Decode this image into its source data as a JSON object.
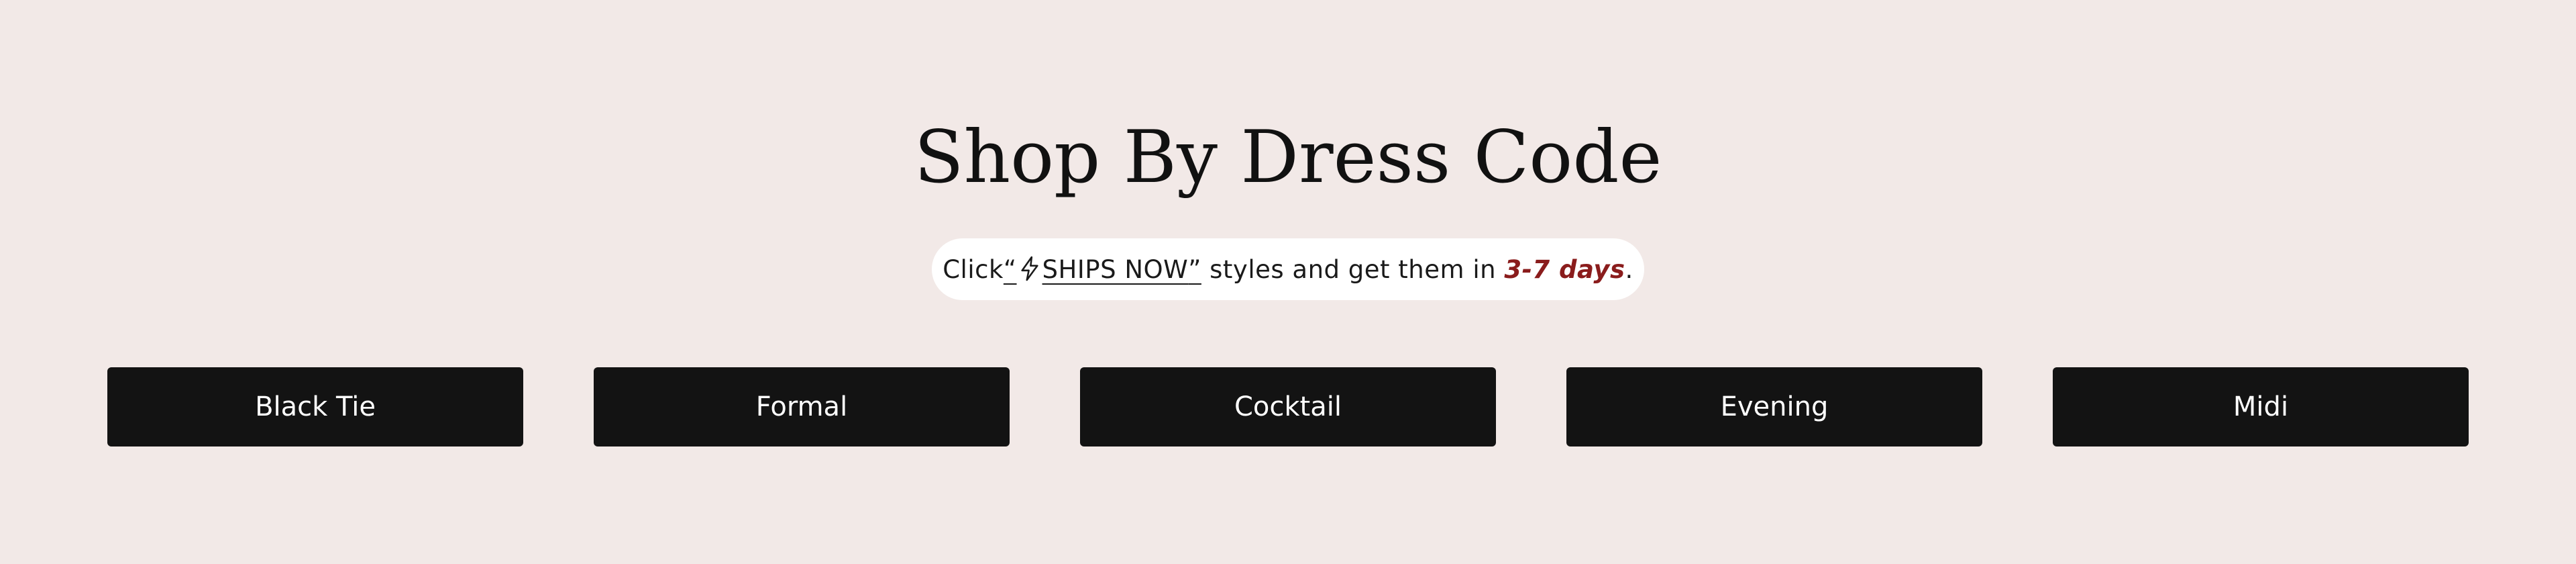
{
  "section": {
    "title": "Shop By Dress Code"
  },
  "notice": {
    "prefix": "Click ",
    "link_open_quote": "“",
    "link_text": "SHIPS NOW",
    "link_close_quote": "”",
    "link_icon": "lightning-bolt-icon",
    "middle": " styles and get them in ",
    "highlight": "3-7 days",
    "suffix": ".",
    "highlight_color": "#8a1c1c"
  },
  "categories": [
    {
      "label": "Black Tie"
    },
    {
      "label": "Formal"
    },
    {
      "label": "Cocktail"
    },
    {
      "label": "Evening"
    },
    {
      "label": "Midi"
    }
  ],
  "colors": {
    "background": "#f2e9e7",
    "button": "#131313",
    "button_text": "#ffffff"
  }
}
